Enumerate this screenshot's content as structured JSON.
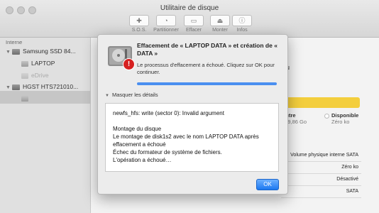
{
  "window": {
    "title": "Utilitaire de disque"
  },
  "toolbar": {
    "items": [
      {
        "label": "S.O.S.",
        "icon": "stethoscope-icon"
      },
      {
        "label": "Partitionner",
        "icon": "partition-icon"
      },
      {
        "label": "Effacer",
        "icon": "erase-icon"
      },
      {
        "label": "Monter",
        "icon": "mount-icon"
      },
      {
        "label": "Infos",
        "icon": "info-icon"
      }
    ]
  },
  "sidebar": {
    "header": "Interne",
    "items": [
      {
        "label": "Samsung SSD 84..."
      },
      {
        "label": "LAPTOP"
      },
      {
        "label": "eDrive"
      },
      {
        "label": "HGST HTS721010..."
      }
    ]
  },
  "main": {
    "partial_text": "du",
    "usage": {
      "other_label": "Autre",
      "other_value": "949,86 Go",
      "free_label": "Disponible",
      "free_value": "Zéro ko"
    },
    "table": [
      "Volume physique interne SATA",
      "Zéro ko",
      "Désactivé",
      "SATA"
    ]
  },
  "dialog": {
    "title": "Effacement de « LAPTOP DATA » et création de « DATA »",
    "message": "Le processus d'effacement a échoué. Cliquez sur OK pour continuer.",
    "progress": 1.0,
    "details_toggle": "Masquer les détails",
    "log_lines": [
      "newfs_hfs: write (sector 0): Invalid argument",
      "",
      "Montage du disque",
      "Le montage de disk1s2 avec le nom LAPTOP DATA après",
      "effacement a échoué",
      "Échec du formateur de système de fichiers.",
      "L'opération a échoué…"
    ],
    "ok_label": "OK"
  },
  "colors": {
    "accent": "#1c78f0",
    "usage_bar": "#f3ce3d",
    "alert": "#d62020"
  }
}
